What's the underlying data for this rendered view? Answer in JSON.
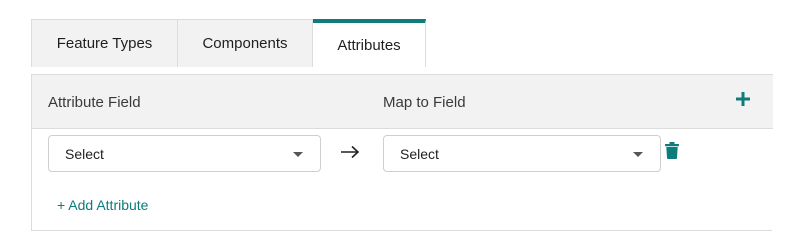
{
  "tabs": [
    {
      "label": "Feature Types"
    },
    {
      "label": "Components"
    },
    {
      "label": "Attributes"
    }
  ],
  "active_tab": "Attributes",
  "mapping_table": {
    "headers": {
      "attribute_field": "Attribute Field",
      "map_to_field": "Map to Field"
    },
    "add_icon": "plus-icon",
    "rows": [
      {
        "attribute_field_value": "Select",
        "map_to_field_value": "Select",
        "arrow_icon": "right-arrow-icon",
        "delete_icon": "trash-icon"
      }
    ],
    "add_attribute_label": "+ Add Attribute"
  },
  "colors": {
    "accent": "#0e7c7b",
    "header_bg": "#f2f2f2",
    "border": "#dcdcdc"
  }
}
